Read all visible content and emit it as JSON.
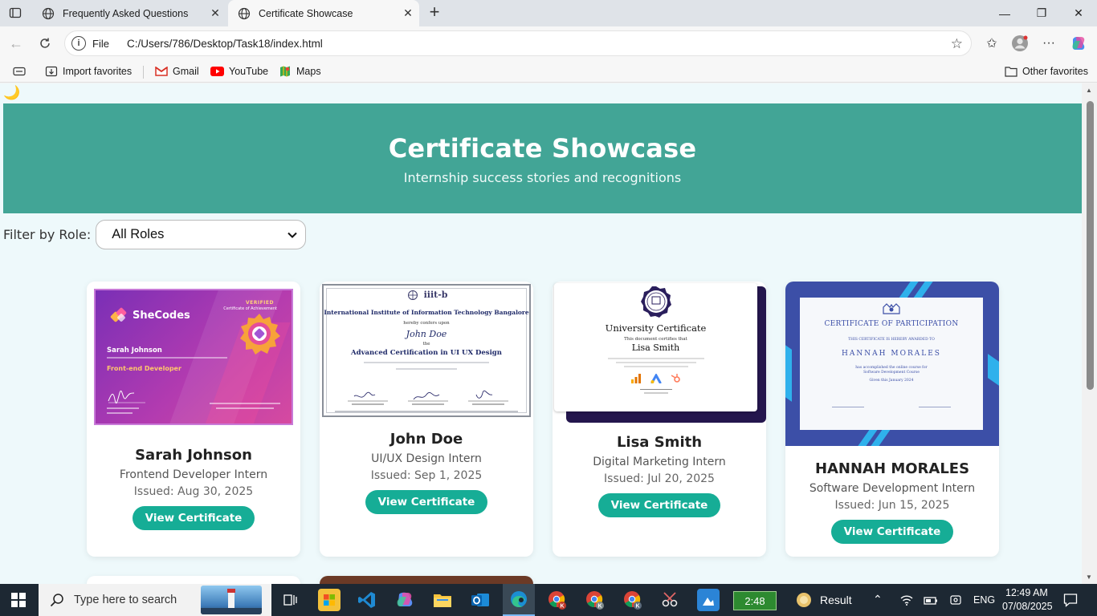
{
  "browser": {
    "tabs": [
      {
        "title": "Frequently Asked Questions",
        "active": false
      },
      {
        "title": "Certificate Showcase",
        "active": true
      }
    ],
    "address": {
      "scheme_label": "File",
      "url": "C:/Users/786/Desktop/Task18/index.html"
    },
    "favorites": [
      {
        "label": "Import favorites",
        "icon": "import-icon"
      },
      {
        "label": "Gmail",
        "icon": "gmail-icon"
      },
      {
        "label": "YouTube",
        "icon": "youtube-icon"
      },
      {
        "label": "Maps",
        "icon": "maps-icon"
      }
    ],
    "other_favorites": "Other favorites"
  },
  "page": {
    "theme_toggle_icon": "moon-icon",
    "hero": {
      "title": "Certificate Showcase",
      "subtitle": "Internship success stories and recognitions"
    },
    "filter": {
      "label": "Filter by Role:",
      "selected": "All Roles"
    },
    "cards": [
      {
        "name": "Sarah Johnson",
        "role": "Frontend Developer Intern",
        "date": "Issued: Aug 30, 2025",
        "button": "View Certificate",
        "cert": {
          "brand": "SheCodes",
          "verified": "VERIFIED",
          "kind": "Certificate of Achievement",
          "holder": "Sarah Johnson",
          "track": "Front-end Developer"
        }
      },
      {
        "name": "John Doe",
        "role": "UI/UX Design Intern",
        "date": "Issued: Sep 1, 2025",
        "button": "View Certificate",
        "cert": {
          "logo": "iiit-b",
          "institute": "International Institute of Information Technology Bangalore",
          "confers": "hereby confers upon",
          "holder": "John Doe",
          "the": "the",
          "program": "Advanced Certification in UI UX Design"
        }
      },
      {
        "name": "Lisa Smith",
        "role": "Digital Marketing Intern",
        "date": "Issued: Jul 20, 2025",
        "button": "View Certificate",
        "cert": {
          "title": "University Certificate",
          "certifies": "This document certifies that",
          "holder": "Lisa Smith"
        }
      },
      {
        "name": "HANNAH MORALES",
        "role": "Software Development Intern",
        "date": "Issued: Jun 15, 2025",
        "button": "View Certificate",
        "cert": {
          "title": "CERTIFICATE OF PARTICIPATION",
          "awarded": "THIS CERTIFICATE IS HEREBY AWARDED TO",
          "holder": "HANNAH MORALES",
          "course": "has accomplished the online course for Software Development Course",
          "given": "Given this January 2024"
        }
      }
    ]
  },
  "taskbar": {
    "search_placeholder": "Type here to search",
    "battery": "2:48",
    "result": "Result",
    "lang": "ENG",
    "time": "12:49 AM",
    "date": "07/08/2025"
  }
}
